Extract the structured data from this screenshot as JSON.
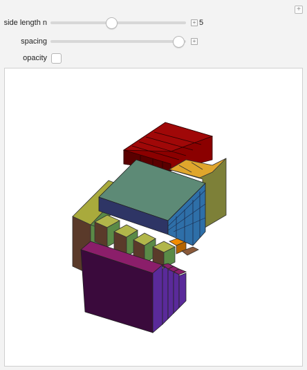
{
  "controls": {
    "side_length_label": "side length n",
    "side_length_value": "5",
    "side_length_fraction": 0.44,
    "spacing_label": "spacing",
    "spacing_fraction": 0.98,
    "opacity_label": "opacity",
    "opacity_checked": false
  },
  "icons": {
    "corner": "plus-icon",
    "slider_expand": "plus-icon"
  },
  "scene": {
    "colors": {
      "maroon": "#8b0000",
      "maroon_dark": "#5a0000",
      "gold": "#e0a62c",
      "olive": "#7d8038",
      "teal_top": "#5d8a76",
      "navy": "#2e3565",
      "steel_blue": "#2e6fa8",
      "sage": "#5a8a47",
      "yellow_green": "#b1b64a",
      "brown": "#5a3a2a",
      "orange": "#f08a00",
      "magenta": "#8b1e6a",
      "plum": "#3a0a3c",
      "violet": "#5a2a9a"
    }
  }
}
